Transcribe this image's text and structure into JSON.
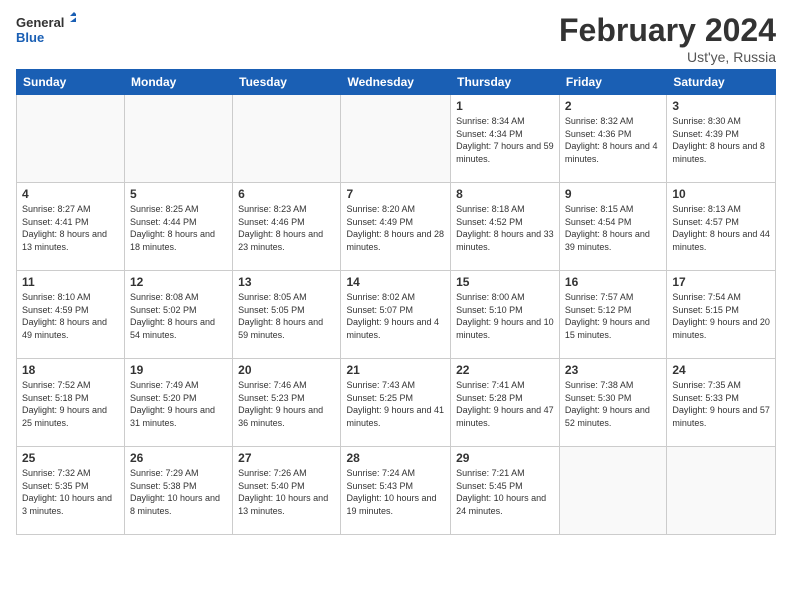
{
  "header": {
    "logo_line1": "General",
    "logo_line2": "Blue",
    "month_title": "February 2024",
    "location": "Ust'ye, Russia"
  },
  "days_of_week": [
    "Sunday",
    "Monday",
    "Tuesday",
    "Wednesday",
    "Thursday",
    "Friday",
    "Saturday"
  ],
  "weeks": [
    [
      {
        "day": "",
        "content": ""
      },
      {
        "day": "",
        "content": ""
      },
      {
        "day": "",
        "content": ""
      },
      {
        "day": "",
        "content": ""
      },
      {
        "day": "1",
        "content": "Sunrise: 8:34 AM\nSunset: 4:34 PM\nDaylight: 7 hours\nand 59 minutes."
      },
      {
        "day": "2",
        "content": "Sunrise: 8:32 AM\nSunset: 4:36 PM\nDaylight: 8 hours\nand 4 minutes."
      },
      {
        "day": "3",
        "content": "Sunrise: 8:30 AM\nSunset: 4:39 PM\nDaylight: 8 hours\nand 8 minutes."
      }
    ],
    [
      {
        "day": "4",
        "content": "Sunrise: 8:27 AM\nSunset: 4:41 PM\nDaylight: 8 hours\nand 13 minutes."
      },
      {
        "day": "5",
        "content": "Sunrise: 8:25 AM\nSunset: 4:44 PM\nDaylight: 8 hours\nand 18 minutes."
      },
      {
        "day": "6",
        "content": "Sunrise: 8:23 AM\nSunset: 4:46 PM\nDaylight: 8 hours\nand 23 minutes."
      },
      {
        "day": "7",
        "content": "Sunrise: 8:20 AM\nSunset: 4:49 PM\nDaylight: 8 hours\nand 28 minutes."
      },
      {
        "day": "8",
        "content": "Sunrise: 8:18 AM\nSunset: 4:52 PM\nDaylight: 8 hours\nand 33 minutes."
      },
      {
        "day": "9",
        "content": "Sunrise: 8:15 AM\nSunset: 4:54 PM\nDaylight: 8 hours\nand 39 minutes."
      },
      {
        "day": "10",
        "content": "Sunrise: 8:13 AM\nSunset: 4:57 PM\nDaylight: 8 hours\nand 44 minutes."
      }
    ],
    [
      {
        "day": "11",
        "content": "Sunrise: 8:10 AM\nSunset: 4:59 PM\nDaylight: 8 hours\nand 49 minutes."
      },
      {
        "day": "12",
        "content": "Sunrise: 8:08 AM\nSunset: 5:02 PM\nDaylight: 8 hours\nand 54 minutes."
      },
      {
        "day": "13",
        "content": "Sunrise: 8:05 AM\nSunset: 5:05 PM\nDaylight: 8 hours\nand 59 minutes."
      },
      {
        "day": "14",
        "content": "Sunrise: 8:02 AM\nSunset: 5:07 PM\nDaylight: 9 hours\nand 4 minutes."
      },
      {
        "day": "15",
        "content": "Sunrise: 8:00 AM\nSunset: 5:10 PM\nDaylight: 9 hours\nand 10 minutes."
      },
      {
        "day": "16",
        "content": "Sunrise: 7:57 AM\nSunset: 5:12 PM\nDaylight: 9 hours\nand 15 minutes."
      },
      {
        "day": "17",
        "content": "Sunrise: 7:54 AM\nSunset: 5:15 PM\nDaylight: 9 hours\nand 20 minutes."
      }
    ],
    [
      {
        "day": "18",
        "content": "Sunrise: 7:52 AM\nSunset: 5:18 PM\nDaylight: 9 hours\nand 25 minutes."
      },
      {
        "day": "19",
        "content": "Sunrise: 7:49 AM\nSunset: 5:20 PM\nDaylight: 9 hours\nand 31 minutes."
      },
      {
        "day": "20",
        "content": "Sunrise: 7:46 AM\nSunset: 5:23 PM\nDaylight: 9 hours\nand 36 minutes."
      },
      {
        "day": "21",
        "content": "Sunrise: 7:43 AM\nSunset: 5:25 PM\nDaylight: 9 hours\nand 41 minutes."
      },
      {
        "day": "22",
        "content": "Sunrise: 7:41 AM\nSunset: 5:28 PM\nDaylight: 9 hours\nand 47 minutes."
      },
      {
        "day": "23",
        "content": "Sunrise: 7:38 AM\nSunset: 5:30 PM\nDaylight: 9 hours\nand 52 minutes."
      },
      {
        "day": "24",
        "content": "Sunrise: 7:35 AM\nSunset: 5:33 PM\nDaylight: 9 hours\nand 57 minutes."
      }
    ],
    [
      {
        "day": "25",
        "content": "Sunrise: 7:32 AM\nSunset: 5:35 PM\nDaylight: 10 hours\nand 3 minutes."
      },
      {
        "day": "26",
        "content": "Sunrise: 7:29 AM\nSunset: 5:38 PM\nDaylight: 10 hours\nand 8 minutes."
      },
      {
        "day": "27",
        "content": "Sunrise: 7:26 AM\nSunset: 5:40 PM\nDaylight: 10 hours\nand 13 minutes."
      },
      {
        "day": "28",
        "content": "Sunrise: 7:24 AM\nSunset: 5:43 PM\nDaylight: 10 hours\nand 19 minutes."
      },
      {
        "day": "29",
        "content": "Sunrise: 7:21 AM\nSunset: 5:45 PM\nDaylight: 10 hours\nand 24 minutes."
      },
      {
        "day": "",
        "content": ""
      },
      {
        "day": "",
        "content": ""
      }
    ]
  ]
}
